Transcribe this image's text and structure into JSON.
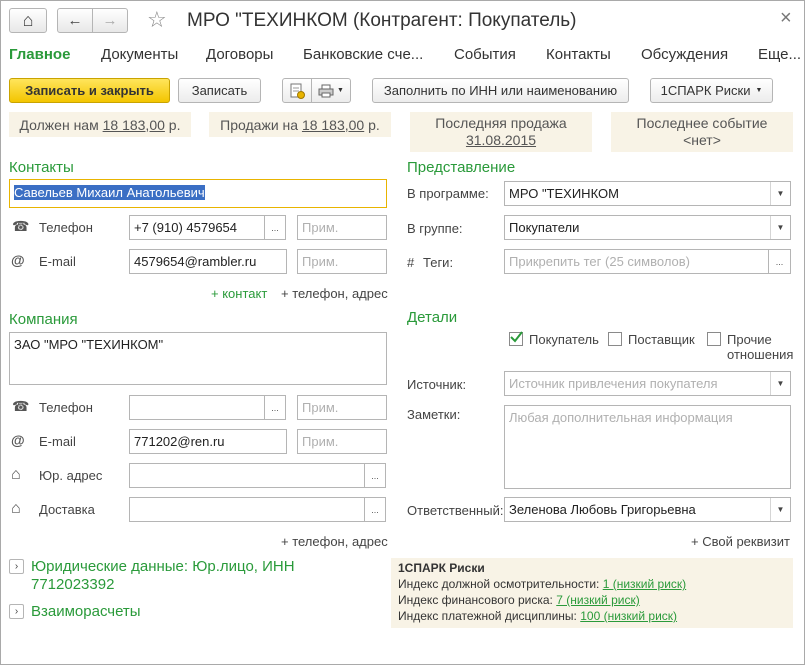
{
  "window": {
    "title": "МРО \"ТЕХИНКОМ (Контрагент: Покупатель)"
  },
  "menu": [
    "Главное",
    "Документы",
    "Договоры",
    "Банковские сче...",
    "События",
    "Контакты",
    "Обсуждения",
    "Еще..."
  ],
  "toolbar": {
    "save_close": "Записать и закрыть",
    "save": "Записать",
    "fill_inn": "Заполнить по ИНН или наименованию",
    "spark": "1СПАРК Риски"
  },
  "info": {
    "owes_label": "Должен нам",
    "owes_value": "18 183,00",
    "owes_cur": "р.",
    "sales_label": "Продажи на",
    "sales_value": "18 183,00",
    "sales_cur": "р.",
    "last_sale_label": "Последняя продажа",
    "last_sale_date": "31.08.2015",
    "last_event_label": "Последнее событие",
    "last_event_value": "<нет>"
  },
  "contacts": {
    "heading": "Контакты",
    "person": "Савельев Михаил Анатольевич",
    "phone_label": "Телефон",
    "phone_value": "+7 (910) 4579654",
    "phone_note_ph": "Прим.",
    "email_label": "E-mail",
    "email_value": "4579654@rambler.ru",
    "email_note_ph": "Прим.",
    "add_contact": "+ контакт",
    "add_phone": "+ телефон, адрес"
  },
  "company": {
    "heading": "Компания",
    "name": "ЗАО \"МРО \"ТЕХИНКОМ\"",
    "phone_label": "Телефон",
    "phone_value": "",
    "phone_note_ph": "Прим.",
    "email_label": "E-mail",
    "email_value": "771202@ren.ru",
    "email_note_ph": "Прим.",
    "legal_label": "Юр. адрес",
    "delivery_label": "Доставка",
    "add_phone": "+ телефон, адрес"
  },
  "representation": {
    "heading": "Представление",
    "program_label": "В программе:",
    "program_value": "МРО \"ТЕХИНКОМ",
    "group_label": "В группе:",
    "group_value": "Покупатели",
    "tags_label": "Теги:",
    "tags_ph": "Прикрепить тег (25 символов)"
  },
  "details": {
    "heading": "Детали",
    "buyer": "Покупатель",
    "supplier": "Поставщик",
    "other": "Прочие",
    "other2": "отношения",
    "source_label": "Источник:",
    "source_ph": "Источник привлечения покупателя",
    "notes_label": "Заметки:",
    "notes_ph": "Любая дополнительная информация",
    "resp_label": "Ответственный:",
    "resp_value": "Зеленова Любовь Григорьевна",
    "add_req": "+ Свой реквизит"
  },
  "bottom": {
    "legal_line1": "Юридические данные: Юр.лицо, ИНН",
    "legal_line2": "7712023392",
    "settlements": "Взаиморасчеты"
  },
  "spark": {
    "title": "1СПАРК Риски",
    "r1_label": "Индекс должной осмотрительности:",
    "r1_value": "1 (низкий риск)",
    "r2_label": "Индекс финансового риска:",
    "r2_value": "7 (низкий риск)",
    "r3_label": "Индекс платежной дисциплины:",
    "r3_value": "100 (низкий риск)"
  },
  "icons": {
    "home": "⌂",
    "back": "←",
    "forward": "→",
    "star": "☆",
    "close": "×",
    "phone": "☎",
    "at": "@",
    "house": "⌂",
    "hash": "#",
    "ellipsis": "...",
    "arrow_down": "▼",
    "expand": "›"
  }
}
